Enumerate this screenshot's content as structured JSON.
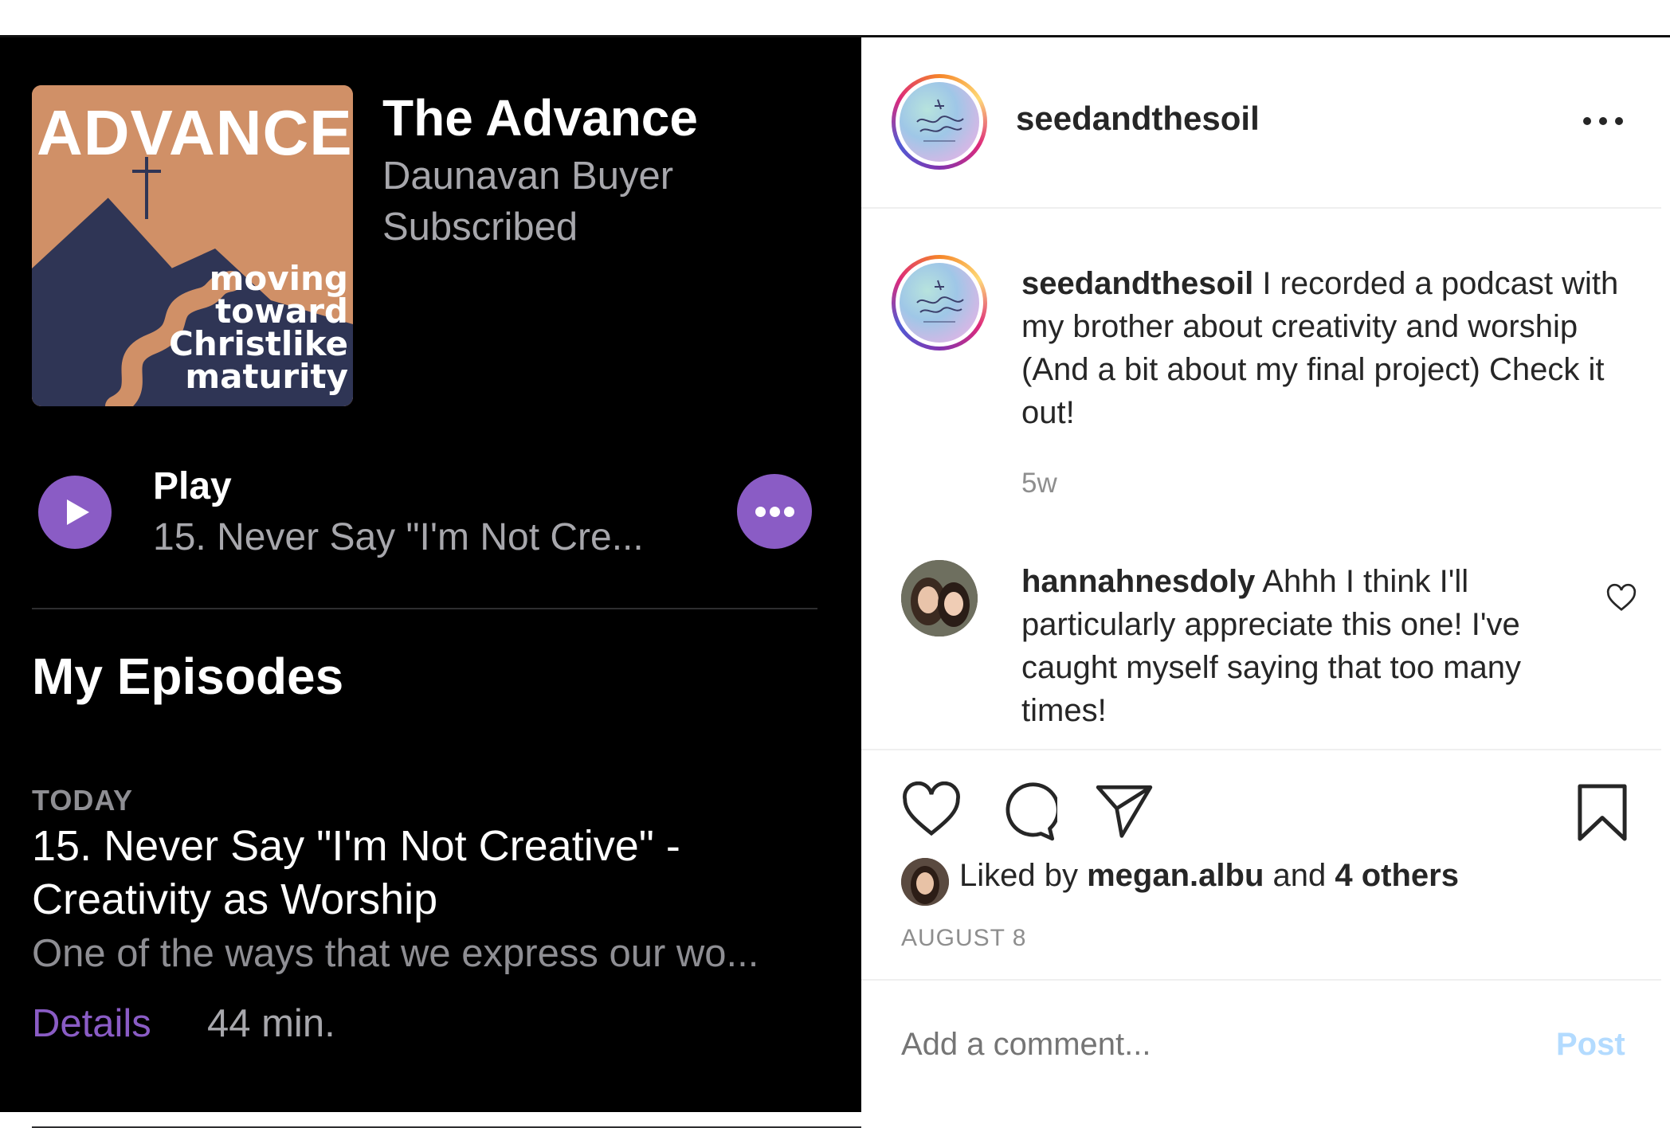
{
  "podcast": {
    "artwork": {
      "title": "ADVANCE",
      "tagline_lines": [
        "moving",
        "toward",
        "Christlike",
        "maturity"
      ]
    },
    "title": "The Advance",
    "author": "Daunavan Buyer",
    "status": "Subscribed",
    "play_label": "Play",
    "play_episode": "15. Never Say \"I'm Not Cre...",
    "section_title": "My Episodes",
    "episode": {
      "date": "TODAY",
      "title": "15. Never Say \"I'm Not Creative\" - Creativity as Worship",
      "description": "One of the ways that we express our wo...",
      "details_label": "Details",
      "duration": "44 min."
    },
    "icons": [
      "play-icon",
      "more-icon"
    ],
    "accent_color": "#8a5cc5"
  },
  "instagram": {
    "username": "seedandthesoil",
    "caption": {
      "username": "seedandthesoil",
      "text": "I recorded a podcast with my brother about creativity and worship (And a bit about my final project) Check it out!",
      "time": "5w"
    },
    "comment": {
      "username": "hannahnesdoly",
      "text": "Ahhh I think I'll particularly appreciate this one! I've caught myself saying that too many times!"
    },
    "likes": {
      "prefix": "Liked by",
      "user": "megan.albu",
      "joiner": "and",
      "others": "4 others"
    },
    "date": "AUGUST 8",
    "comment_placeholder": "Add a comment...",
    "post_label": "Post",
    "icons": [
      "more-icon",
      "heart-icon",
      "comment-icon",
      "share-icon",
      "bookmark-icon"
    ]
  }
}
